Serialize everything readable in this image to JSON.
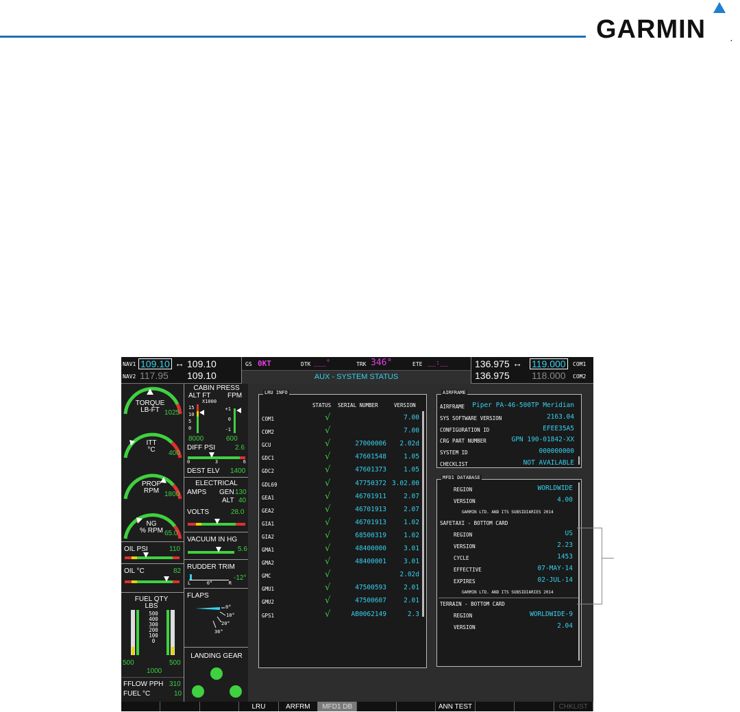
{
  "brand": {
    "name": "GARMIN",
    "reg": "."
  },
  "topbar": {
    "nav1_label": "NAV1",
    "nav1_active": "109.10",
    "nav1_standby": "109.10",
    "nav2_label": "NAV2",
    "nav2_active": "117.95",
    "nav2_standby": "109.10",
    "swap_icon": "↔",
    "gs_label": "GS",
    "gs_value": "0KT",
    "dtk_label": "DTK",
    "dtk_value": "___°",
    "trk_label": "TRK",
    "trk_value": "346°",
    "ete_label": "ETE",
    "ete_value": "__:__",
    "page_title": "AUX - SYSTEM STATUS",
    "com1_standby": "136.975",
    "com1_active": "119.000",
    "com1_label": "COM1",
    "com2_standby": "136.975",
    "com2_active": "118.000",
    "com2_label": "COM2"
  },
  "eis": {
    "torque": {
      "label1": "TORQUE",
      "label2": "LB-FT",
      "value": "1025"
    },
    "itt": {
      "label1": "ITT",
      "label2": "°C",
      "value": "400"
    },
    "prop": {
      "label1": "PROP",
      "label2": "RPM",
      "value": "1800"
    },
    "ng": {
      "label1": "NG",
      "label2": "% RPM",
      "value": "65.0"
    },
    "oil_psi": {
      "label": "OIL PSI",
      "value": "110"
    },
    "oil_c": {
      "label": "OIL °C",
      "value": "82"
    },
    "fuel": {
      "title1": "FUEL QTY",
      "title2": "LBS",
      "ticks": [
        "500",
        "400",
        "300",
        "200",
        "100",
        "0"
      ],
      "left": "500",
      "right": "500",
      "total": "1000"
    },
    "fflow": {
      "label": "FFLOW PPH",
      "value": "310"
    },
    "fuel_c": {
      "label": "FUEL °C",
      "value": "10"
    },
    "cabin": {
      "title": "CABIN PRESS",
      "alt_label": "ALT FT",
      "fpm_label": "FPM",
      "x1000": "X1000",
      "alt_ticks": [
        "15",
        "10",
        "5",
        "0"
      ],
      "fpm_ticks": [
        "+1",
        "0",
        "-1"
      ],
      "alt_value": "8000",
      "fpm_value": "600"
    },
    "diff_psi": {
      "label": "DIFF PSI",
      "value": "2.6",
      "ticks": [
        "0",
        "3",
        "6"
      ]
    },
    "dest_elv": {
      "label": "DEST ELV",
      "value": "1400"
    },
    "electrical": {
      "title": "ELECTRICAL",
      "amps": "AMPS",
      "gen": "GEN",
      "gen_value": "130",
      "alt": "ALT",
      "alt_value": "40",
      "volts": "VOLTS",
      "volts_value": "28.0"
    },
    "vacuum": {
      "label": "VACUUM IN HG",
      "value": "5.6"
    },
    "rudder": {
      "label": "RUDDER TRIM",
      "value": "-12°",
      "ticks": [
        "L",
        "0°",
        "R"
      ]
    },
    "flaps": {
      "label": "FLAPS",
      "ticks": [
        "0°",
        "10°",
        "20°",
        "36°"
      ]
    },
    "gear": {
      "label": "LANDING GEAR"
    }
  },
  "lru": {
    "title": "LRU INFO",
    "headers": [
      "STATUS",
      "SERIAL NUMBER",
      "VERSION"
    ],
    "rows": [
      {
        "name": "COM1",
        "status": true,
        "serial": "",
        "version": "7.00"
      },
      {
        "name": "COM2",
        "status": true,
        "serial": "",
        "version": "7.00"
      },
      {
        "name": "GCU",
        "status": true,
        "serial": "27000006",
        "version": "2.02d"
      },
      {
        "name": "GDC1",
        "status": true,
        "serial": "47601548",
        "version": "1.05"
      },
      {
        "name": "GDC2",
        "status": true,
        "serial": "47601373",
        "version": "1.05"
      },
      {
        "name": "GDL69",
        "status": true,
        "serial": "47750372",
        "version": "3.02.00"
      },
      {
        "name": "GEA1",
        "status": true,
        "serial": "46701911",
        "version": "2.07"
      },
      {
        "name": "GEA2",
        "status": true,
        "serial": "46701913",
        "version": "2.07"
      },
      {
        "name": "GIA1",
        "status": true,
        "serial": "46701913",
        "version": "1.02"
      },
      {
        "name": "GIA2",
        "status": true,
        "serial": "68500319",
        "version": "1.02"
      },
      {
        "name": "GMA1",
        "status": true,
        "serial": "48400000",
        "version": "3.01"
      },
      {
        "name": "GMA2",
        "status": true,
        "serial": "48400001",
        "version": "3.01"
      },
      {
        "name": "GMC",
        "status": true,
        "serial": "",
        "version": "2.02d"
      },
      {
        "name": "GMU1",
        "status": true,
        "serial": "47500593",
        "version": "2.01"
      },
      {
        "name": "GMU2",
        "status": true,
        "serial": "47500607",
        "version": "2.01"
      },
      {
        "name": "GPS1",
        "status": true,
        "serial": "AB0062149",
        "version": "2.3"
      }
    ]
  },
  "airframe": {
    "title": "AIRFRAME",
    "rows": [
      {
        "label": "AIRFRAME",
        "value": "Piper PA-46-500TP Meridian"
      },
      {
        "label": "SYS SOFTWARE VERSION",
        "value": "2163.04"
      },
      {
        "label": "CONFIGURATION ID",
        "value": "EFEE35A5"
      },
      {
        "label": "CRG PART NUMBER",
        "value": "GPN 190-01842-XX"
      },
      {
        "label": "SYSTEM ID",
        "value": "000000000"
      },
      {
        "label": "CHECKLIST",
        "value": "NOT AVAILABLE"
      }
    ]
  },
  "mfd_db": {
    "title": "MFD1 DATABASE",
    "region_label": "REGION",
    "region": "WORLDWIDE",
    "version_label": "VERSION",
    "version": "4.00",
    "copyright": "GARMIN LTD. AND ITS SUBSIDIARIES 2014",
    "safetaxi_title": "SAFETAXI - BOTTOM CARD",
    "st_region_label": "REGION",
    "st_region": "US",
    "st_version_label": "VERSION",
    "st_version": "2.23",
    "st_cycle_label": "CYCLE",
    "st_cycle": "1453",
    "st_effective_label": "EFFECTIVE",
    "st_effective": "07-MAY-14",
    "st_expires_label": "EXPIRES",
    "st_expires": "02-JUL-14",
    "st_copyright": "GARMIN LTD. AND ITS SUBSIDIARIES 2014",
    "terrain_title": "TERRAIN - BOTTOM CARD",
    "tr_region_label": "REGION",
    "tr_region": "WORLDWIDE-9",
    "tr_version_label": "VERSION",
    "tr_version": "2.04"
  },
  "softkeys": [
    "",
    "",
    "",
    "LRU",
    "ARFRM",
    "MFD1 DB",
    "",
    "",
    "ANN TEST",
    "",
    "",
    "CHKLIST"
  ],
  "softkey_active_index": 5,
  "colors": {
    "cyan": "#35d1f0",
    "green": "#3fd13f",
    "magenta": "#e33ee3",
    "bezel": "#2d2d2e",
    "brand_blue": "#1f6fb8"
  }
}
